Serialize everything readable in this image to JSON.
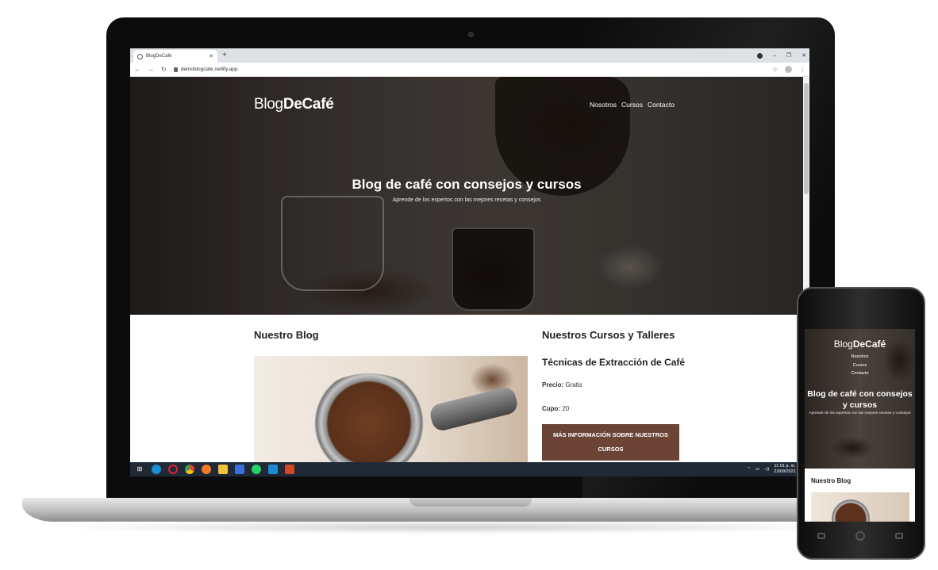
{
  "browser": {
    "tab_title": "BlogDeCafé",
    "new_tab": "+",
    "url": "demoblogcafe.netlify.app"
  },
  "site": {
    "logo_regular": "Blog",
    "logo_bold": "DeCafé",
    "nav": [
      "Nosotros",
      "Cursos",
      "Contacto"
    ],
    "hero_title": "Blog de café con consejos y cursos",
    "hero_subtitle": "Aprende de los expertos con las mejores recetas y consejos",
    "blog_heading": "Nuestro Blog",
    "courses_heading": "Nuestros Cursos y Talleres",
    "course": {
      "name": "Técnicas de Extracción de Café",
      "price_label": "Precio:",
      "price_value": "Gratis",
      "quota_label": "Cupo:",
      "quota_value": "20",
      "button": "Más información sobre nuestros cursos"
    }
  },
  "taskbar": {
    "time": "11:01 p. m.",
    "date": "23/09/2021"
  },
  "mobile": {
    "logo_regular": "Blog",
    "logo_bold": "DeCafé",
    "nav": [
      "Nosotros",
      "Cursos",
      "Contacto"
    ],
    "hero_title": "Blog de café con consejos y cursos",
    "hero_subtitle": "Aprende de los expertos con las mejores recetas y consejos",
    "blog_heading": "Nuestro Blog"
  },
  "colors": {
    "button_brown": "#6b4436",
    "taskbar": "#1f2a36"
  }
}
